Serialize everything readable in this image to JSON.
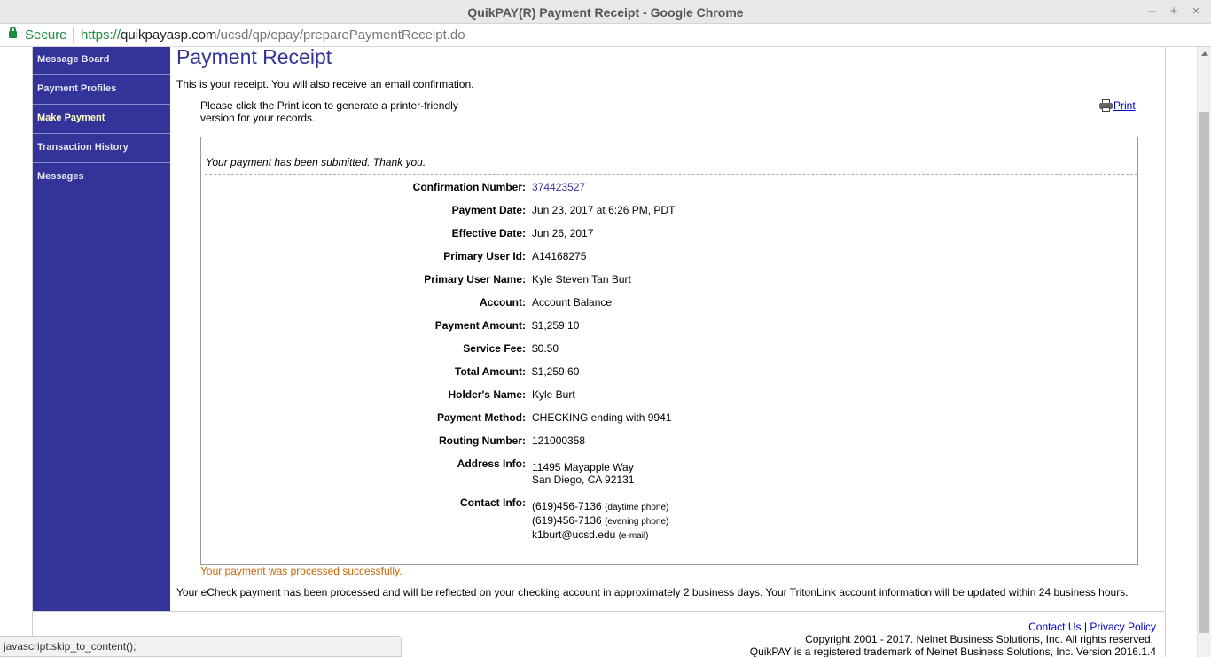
{
  "window": {
    "title": "QuikPAY(R) Payment Receipt - Google Chrome",
    "minimize": "–",
    "maximize": "+",
    "close": "×"
  },
  "addressbar": {
    "secure_label": "Secure",
    "url_scheme": "https://",
    "url_host": "quikpayasp.com",
    "url_path": "/ucsd/qp/epay/preparePaymentReceipt.do"
  },
  "sidebar": {
    "items": [
      {
        "label": "Message Board"
      },
      {
        "label": "Payment Profiles"
      },
      {
        "label": "Make Payment",
        "active": true
      },
      {
        "label": "Transaction History"
      },
      {
        "label": "Messages"
      }
    ]
  },
  "page": {
    "title": "Payment Receipt",
    "intro": "This is your receipt. You will also receive an email confirmation.",
    "print_hint": "Please click the Print icon to generate a printer-friendly version for your records.",
    "print_label": "Print",
    "submitted": "Your payment has been submitted. Thank you."
  },
  "receipt": {
    "confirmation_label": "Confirmation Number:",
    "confirmation_value": "374423527",
    "payment_date_label": "Payment Date:",
    "payment_date_value": "Jun 23, 2017 at 6:26 PM, PDT",
    "effective_date_label": "Effective Date:",
    "effective_date_value": "Jun 26, 2017",
    "user_id_label": "Primary User Id:",
    "user_id_value": "A14168275",
    "user_name_label": "Primary User Name:",
    "user_name_value": "Kyle Steven Tan Burt",
    "account_label": "Account:",
    "account_value": "Account Balance",
    "payment_amount_label": "Payment Amount:",
    "payment_amount_value": "$1,259.10",
    "service_fee_label": "Service Fee:",
    "service_fee_value": "$0.50",
    "total_amount_label": "Total Amount:",
    "total_amount_value": "$1,259.60",
    "holder_label": "Holder's Name:",
    "holder_value": "Kyle Burt",
    "method_label": "Payment Method:",
    "method_value": "CHECKING ending with 9941",
    "routing_label": "Routing Number:",
    "routing_value": "121000358",
    "address_label": "Address Info:",
    "address_line1": "11495 Mayapple Way",
    "address_line2": "San Diego, CA 92131",
    "contact_label": "Contact Info:",
    "phone_day": "(619)456-7136",
    "phone_day_note": "(daytime phone)",
    "phone_eve": "(619)456-7136",
    "phone_eve_note": "(evening phone)",
    "email": "k1burt@ucsd.edu",
    "email_note": "(e-mail)"
  },
  "messages": {
    "success": "Your payment was processed successfully.",
    "echeck": "Your eCheck payment has been processed and will be reflected on your checking account in approximately 2 business days. Your TritonLink account information will be updated within 24 business hours."
  },
  "footer": {
    "contact_us": "Contact Us",
    "divider": "|",
    "privacy_policy": "Privacy Policy",
    "copyright": "Copyright 2001 - 2017. Nelnet Business Solutions, Inc. All rights reserved.",
    "trademark": "QuikPAY is a registered trademark of Nelnet Business Solutions, Inc. Version 2016.1.4"
  },
  "status": {
    "text": "javascript:skip_to_content();"
  }
}
